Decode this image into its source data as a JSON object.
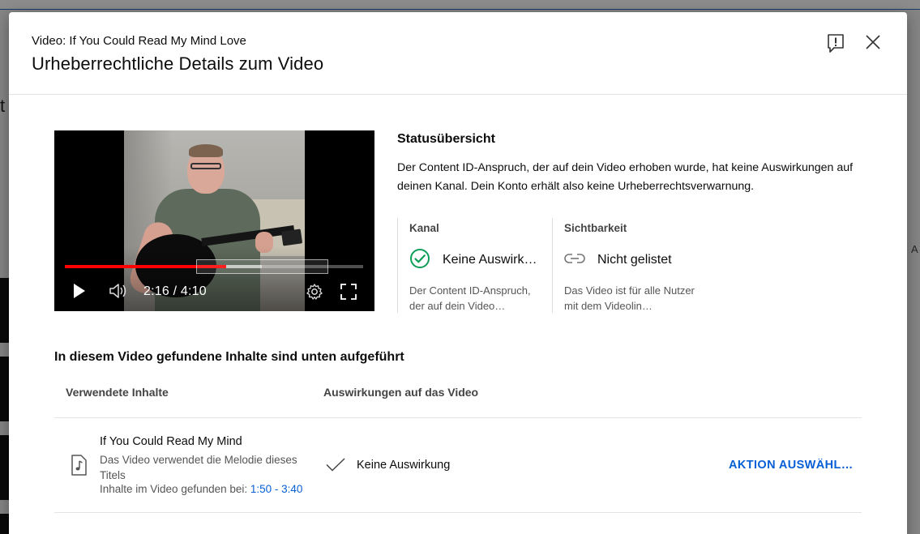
{
  "background_page": {
    "letter_partial": "t",
    "right_text_partial": "A"
  },
  "dialog": {
    "subtitle": "Video: If You Could Read My Mind Love",
    "title": "Urheberrechtliche Details zum Video",
    "icons": {
      "report": "report-flag-icon",
      "close": "close-icon"
    }
  },
  "player": {
    "time": "2:16 / 4:10",
    "progress_fraction": 0.541,
    "buffered_fraction": 0.66,
    "icons": [
      "play-icon",
      "volume-icon",
      "settings-gear-icon",
      "fullscreen-icon"
    ],
    "accent_color": "#ff0000"
  },
  "status": {
    "title": "Statusübersicht",
    "description": "Der Content ID-Anspruch, der auf dein Video erhoben wurde, hat keine Auswirkungen auf deinen Kanal. Dein Konto erhält also keine Urheberrechtsverwarnung.",
    "channel": {
      "label": "Kanal",
      "value": "Keine Auswirkungen",
      "note": "Der Content ID-Anspruch, der auf dein Video…",
      "icon": "check-circle-icon",
      "icon_color": "#0f9d58"
    },
    "visibility": {
      "label": "Sichtbarkeit",
      "value": "Nicht gelistet",
      "note": "Das Video ist für alle Nutzer mit dem Videolin…",
      "icon": "link-icon"
    }
  },
  "found": {
    "title": "In diesem Video gefundene Inhalte sind unten aufgeführt",
    "columns": {
      "used": "Verwendete Inhalte",
      "impact": "Auswirkungen auf das Video"
    },
    "rows": [
      {
        "title": "If You Could Read My Mind",
        "description": "Das Video verwendet die Melodie dieses Titels",
        "found_label": "Inhalte im Video gefunden bei: ",
        "found_time": "1:50 - 3:40",
        "impact": "Keine Auswirkung",
        "action": "AKTION AUSWÄHLEN",
        "icon": "music-note-icon"
      }
    ]
  },
  "colors": {
    "link": "#065fd4",
    "divider": "#e3e3e3"
  }
}
